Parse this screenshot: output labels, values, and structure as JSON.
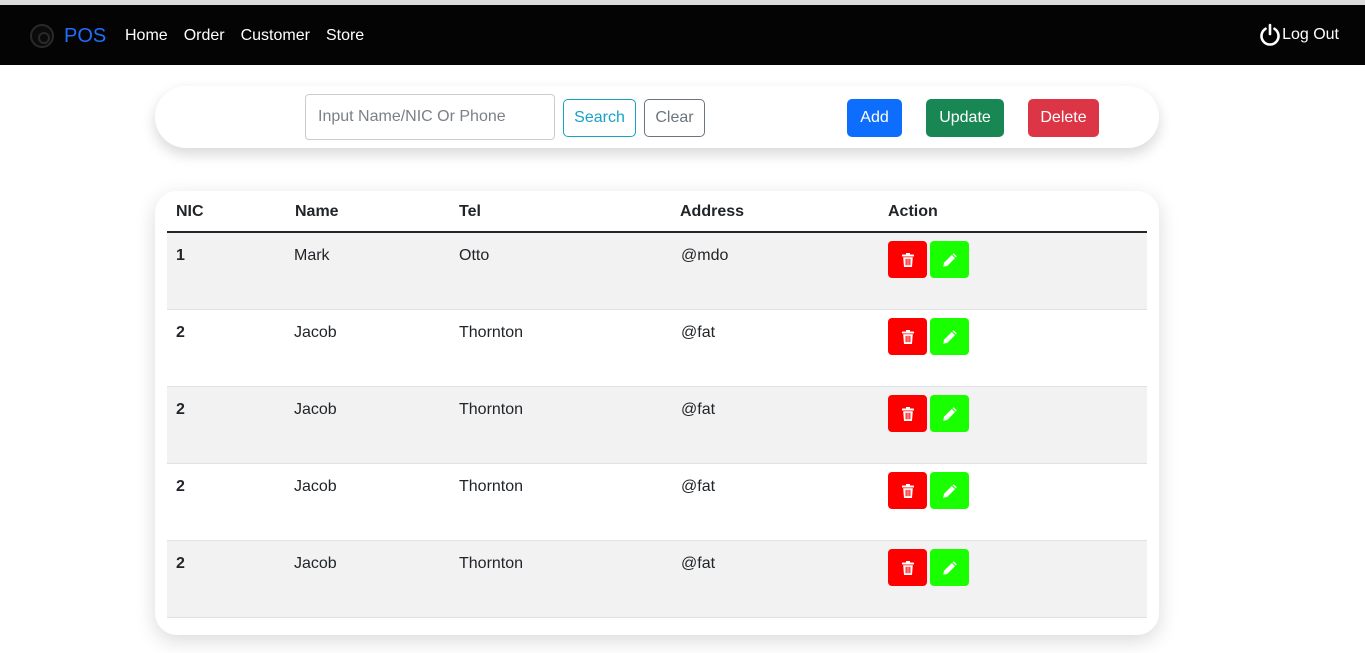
{
  "navbar": {
    "brand": "POS",
    "links": [
      "Home",
      "Order",
      "Customer",
      "Store"
    ],
    "logout_label": "Log Out"
  },
  "toolbar": {
    "search_placeholder": "Input Name/NIC Or Phone",
    "search_value": "",
    "search_label": "Search",
    "clear_label": "Clear",
    "add_label": "Add",
    "update_label": "Update",
    "delete_label": "Delete"
  },
  "table": {
    "headers": [
      "NIC",
      "Name",
      "Tel",
      "Address",
      "Action"
    ],
    "rows": [
      {
        "nic": "1",
        "name": "Mark",
        "tel": "Otto",
        "address": "@mdo"
      },
      {
        "nic": "2",
        "name": "Jacob",
        "tel": "Thornton",
        "address": "@fat"
      },
      {
        "nic": "2",
        "name": "Jacob",
        "tel": "Thornton",
        "address": "@fat"
      },
      {
        "nic": "2",
        "name": "Jacob",
        "tel": "Thornton",
        "address": "@fat"
      },
      {
        "nic": "2",
        "name": "Jacob",
        "tel": "Thornton",
        "address": "@fat"
      }
    ],
    "row_actions": [
      {
        "name": "delete-row",
        "icon": "trash-icon",
        "color": "#ff0000"
      },
      {
        "name": "edit-row",
        "icon": "pencil-icon",
        "color": "#1aff00"
      }
    ]
  },
  "colors": {
    "navbar_bg": "#040404",
    "brand": "#1f6fff",
    "add": "#0d6efd",
    "update": "#198754",
    "delete": "#dc3545",
    "search_outline": "#17a2c6",
    "clear_outline": "#6c757d"
  }
}
